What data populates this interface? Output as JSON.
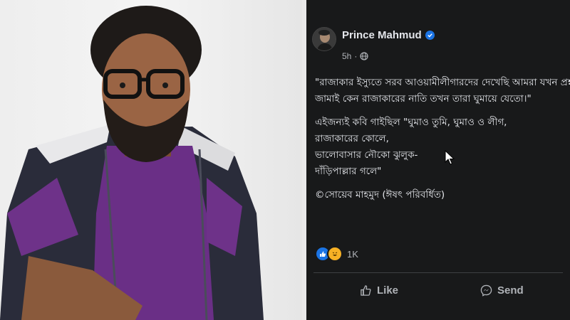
{
  "post": {
    "author": "Prince Mahmud",
    "time": "5h",
    "lines": [
      "\"রাজাকার ইস্যুতে সরব আওয়ামীলীগারদের দেখেছি আমরা যখন প্রশ্ন করতাম",
      "জামাই কেন রাজাকারের নাতি তখন তারা ঘুমায়ে যেতো।\"",
      "এইজন্যই কবি গাইছিল \"ঘুমাও তুমি, ঘুমাও ও লীগ,",
      "রাজাকারের কোলে,",
      "ভালোবাসার নৌকো ঝুলুক-",
      "দাঁড়িপাল্লার গলে\"",
      "©সোয়েব মাহমুদ (ঈষৎ পরিবর্ধিত)"
    ],
    "reaction_count": "1K",
    "like_label": "Like",
    "send_label": "Send"
  },
  "icons": {
    "verified": "verified-badge-icon",
    "audience": "globe-icon",
    "like": "thumbs-up-icon",
    "send": "messenger-icon",
    "reaction_like": "like-reaction-icon",
    "reaction_haha": "haha-reaction-icon"
  },
  "colors": {
    "post_background": "#18191a",
    "text_primary": "#e4e6eb",
    "text_secondary": "#b0b3b8",
    "accent": "#1b74e4"
  }
}
